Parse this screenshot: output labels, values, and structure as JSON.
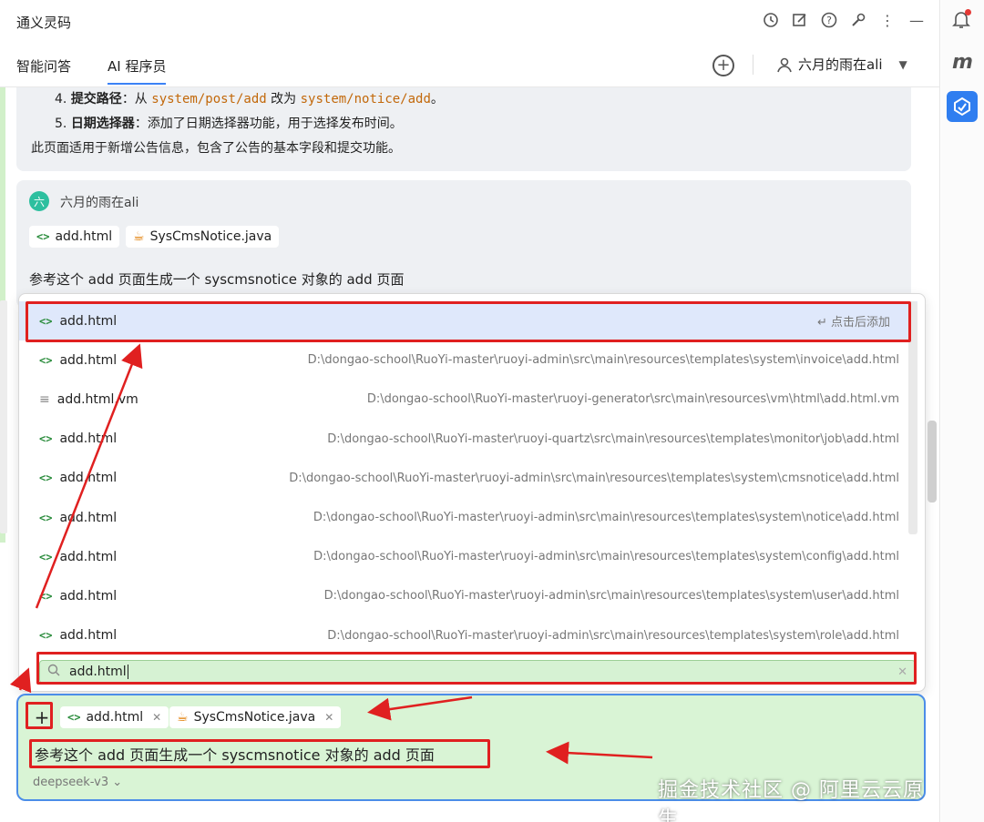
{
  "window": {
    "title": "通义灵码"
  },
  "tabs": {
    "chat": "智能问答",
    "ai": "AI 程序员"
  },
  "user": {
    "name": "六月的雨在ali"
  },
  "message1": {
    "items": [
      {
        "num": "4.",
        "label": "提交路径",
        "sep": "：从 ",
        "code1": "system/post/add",
        "mid": " 改为 ",
        "code2": "system/notice/add",
        "end": "。"
      },
      {
        "num": "5.",
        "label": "日期选择器",
        "sep": "：",
        "text": "添加了日期选择器功能，用于选择发布时间。"
      }
    ],
    "summary": "此页面适用于新增公告信息，包含了公告的基本字段和提交功能。"
  },
  "message2": {
    "avatar": "六",
    "author": "六月的雨在ali",
    "chips": [
      "add.html",
      "SysCmsNotice.java"
    ],
    "text": "参考这个 add 页面生成一个 syscmsnotice 对象的 add 页面"
  },
  "popup": {
    "hint": "点击后添加",
    "rows": [
      {
        "name": "add.html",
        "path": "",
        "icon": "code-icon"
      },
      {
        "name": "add.html",
        "path": "D:\\dongao-school\\RuoYi-master\\ruoyi-admin\\src\\main\\resources\\templates\\system\\invoice\\add.html",
        "icon": "code-icon"
      },
      {
        "name": "add.html.vm",
        "path": "D:\\dongao-school\\RuoYi-master\\ruoyi-generator\\src\\main\\resources\\vm\\html\\add.html.vm",
        "icon": "text-lines-icon"
      },
      {
        "name": "add.html",
        "path": "D:\\dongao-school\\RuoYi-master\\ruoyi-quartz\\src\\main\\resources\\templates\\monitor\\job\\add.html",
        "icon": "code-icon"
      },
      {
        "name": "add.html",
        "path": "D:\\dongao-school\\RuoYi-master\\ruoyi-admin\\src\\main\\resources\\templates\\system\\cmsnotice\\add.html",
        "icon": "code-icon"
      },
      {
        "name": "add.html",
        "path": "D:\\dongao-school\\RuoYi-master\\ruoyi-admin\\src\\main\\resources\\templates\\system\\notice\\add.html",
        "icon": "code-icon"
      },
      {
        "name": "add.html",
        "path": "D:\\dongao-school\\RuoYi-master\\ruoyi-admin\\src\\main\\resources\\templates\\system\\config\\add.html",
        "icon": "code-icon"
      },
      {
        "name": "add.html",
        "path": "D:\\dongao-school\\RuoYi-master\\ruoyi-admin\\src\\main\\resources\\templates\\system\\user\\add.html",
        "icon": "code-icon"
      },
      {
        "name": "add.html",
        "path": "D:\\dongao-school\\RuoYi-master\\ruoyi-admin\\src\\main\\resources\\templates\\system\\role\\add.html",
        "icon": "code-icon"
      }
    ],
    "search_value": "add.html"
  },
  "input": {
    "chips": [
      "add.html",
      "SysCmsNotice.java"
    ],
    "text": "参考这个 add 页面生成一个 syscmsnotice 对象的 add 页面",
    "model": "deepseek-v3"
  },
  "watermark": "掘金技术社区 @ 阿里云云原生",
  "colors": {
    "accent": "#3b82f6",
    "highlight": "#e02020",
    "input_bg": "#d9f4d5"
  }
}
